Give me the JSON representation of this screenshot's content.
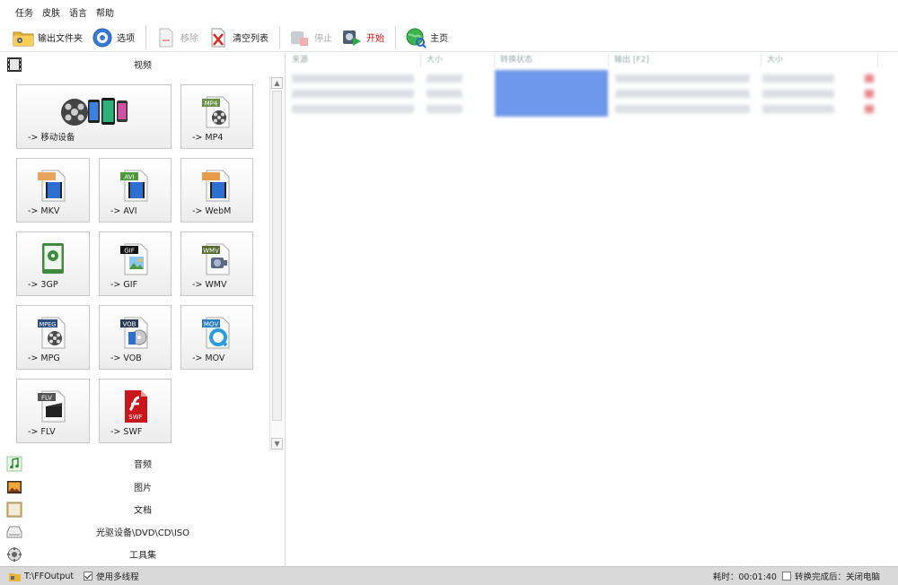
{
  "menu": [
    "任务",
    "皮肤",
    "语言",
    "帮助"
  ],
  "toolbar": {
    "output_folder": "输出文件夹",
    "options": "选项",
    "remove": "移除",
    "clear_list": "清空列表",
    "stop": "停止",
    "start": "开始",
    "home": "主页"
  },
  "sidebar": {
    "video_header": "视频",
    "tiles": [
      {
        "label": "-> 移动设备",
        "icon": "mobile-devices-icon"
      },
      {
        "label": "-> MP4",
        "icon": "mp4-file-icon"
      },
      {
        "label": "-> MKV",
        "icon": "mkv-file-icon"
      },
      {
        "label": "-> AVI",
        "icon": "avi-file-icon"
      },
      {
        "label": "-> WebM",
        "icon": "webm-file-icon"
      },
      {
        "label": "-> 3GP",
        "icon": "3gp-file-icon"
      },
      {
        "label": "-> GIF",
        "icon": "gif-file-icon"
      },
      {
        "label": "-> WMV",
        "icon": "wmv-file-icon"
      },
      {
        "label": "-> MPG",
        "icon": "mpg-file-icon"
      },
      {
        "label": "-> VOB",
        "icon": "vob-file-icon"
      },
      {
        "label": "-> MOV",
        "icon": "mov-file-icon"
      },
      {
        "label": "-> FLV",
        "icon": "flv-file-icon"
      },
      {
        "label": "-> SWF",
        "icon": "swf-file-icon"
      }
    ],
    "icon_tags": {
      "mp4": "MP4",
      "avi": "AVI",
      "gif": "GIF",
      "wmv": "WMV",
      "mpeg": "MPEG",
      "vob": "VOB",
      "mov": "MOV",
      "flv": "FLV",
      "swf": "SWF"
    },
    "categories": [
      {
        "label": "音频",
        "icon": "music-note-icon"
      },
      {
        "label": "图片",
        "icon": "picture-icon"
      },
      {
        "label": "文档",
        "icon": "document-icon"
      },
      {
        "label": "光驱设备\\DVD\\CD\\ISO",
        "icon": "optical-drive-icon"
      },
      {
        "label": "工具集",
        "icon": "toolbox-icon"
      }
    ]
  },
  "table": {
    "columns": [
      "来源",
      "大小",
      "转换状态",
      "输出 [F2]",
      "大小"
    ]
  },
  "statusbar": {
    "output_path": "T:\\FFOutput",
    "multithread_label": "使用多线程",
    "elapsed": "耗时：00:01:40",
    "after_convert": "转换完成后：关闭电脑"
  },
  "colors": {
    "progress": "#6f98ea",
    "start_label": "#d01010",
    "statusbar_bg": "#d9d9d9"
  }
}
